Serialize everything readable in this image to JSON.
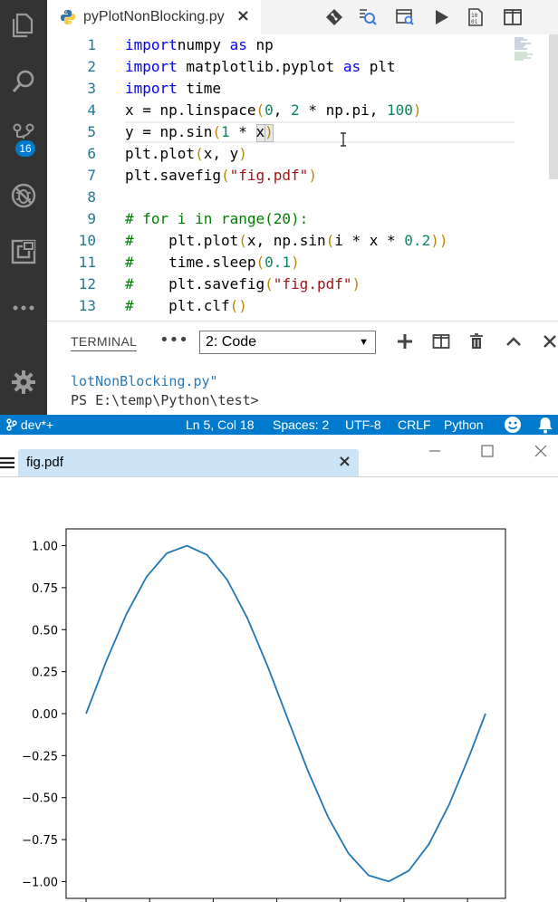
{
  "editor": {
    "tab_label": "pyPlotNonBlocking.py",
    "tab_close": "×",
    "lines": [
      {
        "n": "1",
        "html": [
          [
            "kw",
            "import"
          ],
          [
            "",
            "numpy"
          ],
          [
            "kw",
            " as"
          ],
          [
            "",
            " np"
          ]
        ]
      },
      {
        "n": "2",
        "html": [
          [
            "kw",
            "import"
          ],
          [
            "",
            " matplotlib.pyplot"
          ],
          [
            "kw",
            " as"
          ],
          [
            "",
            " plt"
          ]
        ]
      },
      {
        "n": "3",
        "html": [
          [
            "kw",
            "import"
          ],
          [
            "",
            " time"
          ]
        ]
      },
      {
        "n": "4",
        "html": [
          [
            "",
            "x = np.linspace"
          ],
          [
            "paren",
            "("
          ],
          [
            "num",
            "0"
          ],
          [
            "",
            ", "
          ],
          [
            "num",
            "2"
          ],
          [
            "",
            " * np.pi, "
          ],
          [
            "num",
            "100"
          ],
          [
            "paren",
            ")"
          ]
        ]
      },
      {
        "n": "5",
        "html": [
          [
            "",
            "y = np.sin"
          ],
          [
            "paren",
            "("
          ],
          [
            "num",
            "1"
          ],
          [
            "",
            " * x"
          ],
          [
            "paren",
            ")"
          ]
        ]
      },
      {
        "n": "6",
        "html": [
          [
            "",
            "plt.plot"
          ],
          [
            "paren",
            "("
          ],
          [
            "",
            "x, y"
          ],
          [
            "paren",
            ")"
          ]
        ]
      },
      {
        "n": "7",
        "html": [
          [
            "",
            "plt.savefig"
          ],
          [
            "paren",
            "("
          ],
          [
            "str",
            "\"fig.pdf\""
          ],
          [
            "paren",
            ")"
          ]
        ]
      },
      {
        "n": "8",
        "html": []
      },
      {
        "n": "9",
        "html": [
          [
            "cm",
            "# for i in range(20):"
          ]
        ]
      },
      {
        "n": "10",
        "html": [
          [
            "cm",
            "#"
          ],
          [
            "",
            " "
          ],
          [
            "",
            "   plt.plot"
          ],
          [
            "paren",
            "("
          ],
          [
            "",
            "x, np.sin"
          ],
          [
            "paren",
            "("
          ],
          [
            "",
            "i * x * "
          ],
          [
            "num",
            "0.2"
          ],
          [
            "paren",
            "))"
          ]
        ]
      },
      {
        "n": "11",
        "html": [
          [
            "cm",
            "#"
          ],
          [
            "",
            " "
          ],
          [
            "",
            "   time.sleep"
          ],
          [
            "paren",
            "("
          ],
          [
            "num",
            "0.1"
          ],
          [
            "paren",
            ")"
          ]
        ]
      },
      {
        "n": "12",
        "html": [
          [
            "cm",
            "#"
          ],
          [
            "",
            " "
          ],
          [
            "",
            "   plt.savefig"
          ],
          [
            "paren",
            "("
          ],
          [
            "str",
            "\"fig.pdf\""
          ],
          [
            "paren",
            ")"
          ]
        ]
      },
      {
        "n": "13",
        "html": [
          [
            "cm",
            "#"
          ],
          [
            "",
            " "
          ],
          [
            "",
            "   plt.clf"
          ],
          [
            "paren",
            "()"
          ]
        ]
      }
    ]
  },
  "activity": {
    "scm_badge": "16",
    "icons": [
      "files-icon",
      "search-icon",
      "source-control-icon",
      "debug-icon",
      "extensions-icon",
      "more-icon",
      "settings-gear-icon"
    ]
  },
  "panel": {
    "title": "TERMINAL",
    "more": "•••",
    "select_value": "2: Code",
    "terminal_lines": [
      "lotNonBlocking.py\"",
      "PS E:\\temp\\Python\\test>"
    ]
  },
  "status": {
    "branch": "dev*+",
    "position": "Ln 5, Col 18",
    "spaces": "Spaces: 2",
    "encoding": "UTF-8",
    "eol": "CRLF",
    "language": "Python"
  },
  "pdf": {
    "tab_label": "fig.pdf",
    "tab_close": "×"
  },
  "chart_data": {
    "type": "line",
    "title": "",
    "xlabel": "",
    "ylabel": "",
    "xlim": [
      -0.314,
      6.597
    ],
    "ylim": [
      -1.1,
      1.1
    ],
    "xticks": [
      0,
      1,
      2,
      3,
      4,
      5,
      6
    ],
    "yticks": [
      -1.0,
      -0.75,
      -0.5,
      -0.25,
      0.0,
      0.25,
      0.5,
      0.75,
      1.0
    ],
    "ytick_labels": [
      "−1.00",
      "−0.75",
      "−0.50",
      "−0.25",
      "0.00",
      "0.25",
      "0.50",
      "0.75",
      "1.00"
    ],
    "grid": false,
    "series": [
      {
        "color": "#1f77b4",
        "x": [
          0.0,
          0.317,
          0.635,
          0.952,
          1.269,
          1.587,
          1.904,
          2.221,
          2.539,
          2.856,
          3.173,
          3.491,
          3.808,
          4.125,
          4.443,
          4.76,
          5.077,
          5.395,
          5.712,
          6.029,
          6.283
        ],
        "y": [
          0.0,
          0.312,
          0.593,
          0.815,
          0.955,
          1.0,
          0.945,
          0.796,
          0.567,
          0.282,
          -0.032,
          -0.342,
          -0.617,
          -0.831,
          -0.963,
          -0.999,
          -0.935,
          -0.776,
          -0.541,
          -0.251,
          0.0
        ]
      }
    ]
  }
}
